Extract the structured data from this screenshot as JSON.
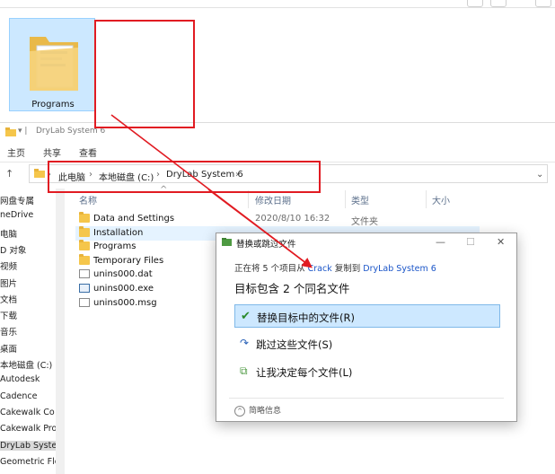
{
  "folder_tile": {
    "label": "Programs"
  },
  "explorer": {
    "title": "DryLab System 6",
    "ribbon": [
      "主页",
      "共享",
      "查看"
    ],
    "breadcrumb": [
      "此电脑",
      "本地磁盘 (C:)",
      "DryLab System 6"
    ],
    "columns": [
      "名称",
      "修改日期",
      "类型",
      "大小"
    ],
    "files": [
      {
        "name": "Data and Settings",
        "date": "2020/8/10 16:32",
        "type": "文件夹",
        "kind": "folder"
      },
      {
        "name": "Installation",
        "date": "",
        "type": "",
        "kind": "folder"
      },
      {
        "name": "Programs",
        "date": "",
        "type": "",
        "kind": "folder"
      },
      {
        "name": "Temporary Files",
        "date": "",
        "type": "",
        "kind": "folder"
      },
      {
        "name": "unins000.dat",
        "date": "",
        "type": "",
        "kind": "dat"
      },
      {
        "name": "unins000.exe",
        "date": "",
        "type": "",
        "kind": "exe"
      },
      {
        "name": "unins000.msg",
        "date": "",
        "type": "",
        "kind": "doc"
      }
    ],
    "sidebar": [
      "网盘专属",
      "neDrive",
      "电脑",
      "D 对象",
      "视频",
      "图片",
      "文档",
      "下载",
      "音乐",
      "桌面",
      "本地磁盘 (C:)",
      "Autodesk",
      "Cadence",
      "Cakewalk Co",
      "Cakewalk Pro",
      "DryLab Syster",
      "Geometric Fle"
    ]
  },
  "dialog": {
    "title": "替换或跳过文件",
    "progress_prefix": "正在将 5 个项目从",
    "source": "Crack",
    "mid": "复制到",
    "dest": "DryLab System 6",
    "heading": "目标包含 2 个同名文件",
    "options": [
      "替换目标中的文件(R)",
      "跳过这些文件(S)",
      "让我决定每个文件(L)"
    ],
    "footer": "简略信息",
    "btn_min": "—",
    "btn_max": "☐",
    "btn_close": "✕"
  },
  "colors": {
    "annotation": "#e11b22",
    "accent": "#0078d7",
    "selection": "#cde8ff"
  }
}
